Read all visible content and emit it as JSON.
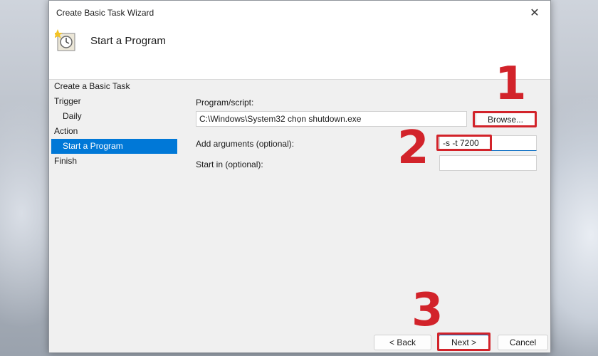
{
  "window": {
    "title": "Create Basic Task Wizard",
    "close_glyph": "✕"
  },
  "header": {
    "title": "Start a Program",
    "icon": "clock-task-icon"
  },
  "nav": {
    "items": [
      {
        "label": "Create a Basic Task"
      },
      {
        "label": "Trigger"
      },
      {
        "label": "Daily"
      },
      {
        "label": "Action"
      },
      {
        "label": "Start a Program"
      },
      {
        "label": "Finish"
      }
    ]
  },
  "form": {
    "program_label": "Program/script:",
    "program_value": "C:\\Windows\\System32 chọn shutdown.exe",
    "browse_label": "Browse...",
    "arguments_label": "Add arguments (optional):",
    "arguments_value": "-s -t 7200",
    "startin_label": "Start in (optional):",
    "startin_value": ""
  },
  "footer": {
    "back_label": "< Back",
    "next_label": "Next >",
    "cancel_label": "Cancel"
  },
  "annotations": {
    "step1": "1",
    "step2": "2",
    "step3": "3",
    "color": "#d2232a"
  },
  "colors": {
    "selection": "#0078d7"
  }
}
